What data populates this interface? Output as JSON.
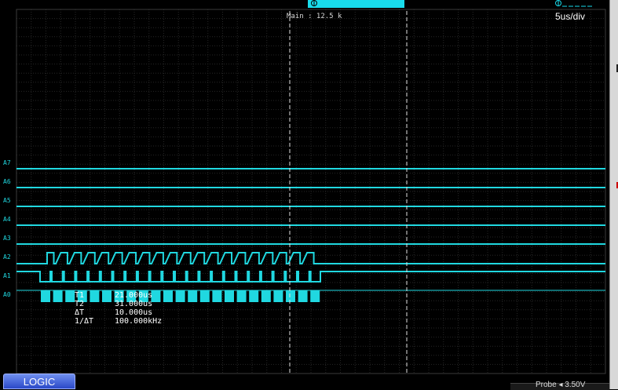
{
  "header": {
    "zoom_label": "Main : 12.5 k",
    "timebase": "5us/div"
  },
  "channels": [
    "A7",
    "A6",
    "A5",
    "A4",
    "A3",
    "A2",
    "A1",
    "A0"
  ],
  "measurements": [
    {
      "label": "T1",
      "value": "21.000us"
    },
    {
      "label": "T2",
      "value": "31.000us"
    },
    {
      "label": "ΔT",
      "value": "10.000us"
    },
    {
      "label": "1/ΔT",
      "value": "100.000kHz"
    }
  ],
  "tabs": {
    "logic_label": "LOGIC"
  },
  "status": {
    "probe_label": "Probe ◂ 3.50V"
  },
  "colors": {
    "trace": "#20d8e0",
    "grid": "#2a2a2a",
    "cursor": "#e0e0e0"
  }
}
